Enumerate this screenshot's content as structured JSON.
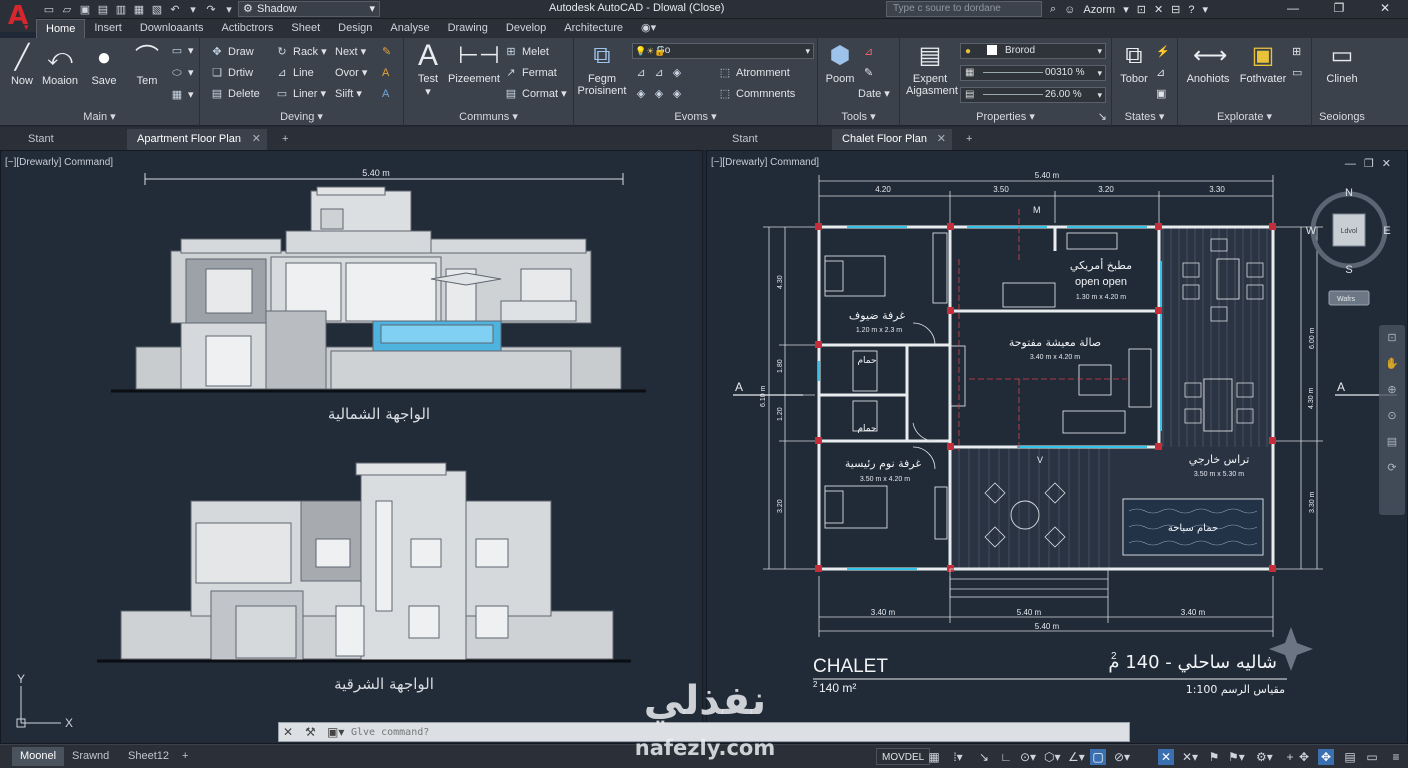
{
  "app": {
    "logo_letter": "A",
    "title": "Autodesk AutoCAD - Dlowal (Close)",
    "workspace": "Shadow",
    "search_placeholder": "Type c soure to dordane",
    "user": "Azorm"
  },
  "ribbon_tabs": [
    "Home",
    "Insert",
    "Downloaants",
    "Actibctrors",
    "Sheet",
    "Design",
    "Analyse",
    "Drawing",
    "Develop",
    "Architecture"
  ],
  "panels": {
    "main": {
      "title": "Main",
      "buttons": [
        "Now",
        "Moaion",
        "Save",
        "Tem"
      ]
    },
    "deving": {
      "title": "Deving",
      "items": [
        "Draw",
        "Drtiw",
        "Delete",
        "Rack",
        "Line",
        "Liner",
        "Next",
        "Ovor",
        "Siift"
      ]
    },
    "communs": {
      "title": "Communs",
      "buttons": [
        "Test",
        "Pizeement"
      ],
      "items": [
        "Melet",
        "Fermat",
        "Cormat"
      ]
    },
    "evoms": {
      "title": "Evoms",
      "buttons": [
        "Fegm Proisinent"
      ],
      "combo": "Go",
      "items": [
        "Atromment",
        "Commnents"
      ]
    },
    "tools": {
      "title": "Tools",
      "buttons": [
        "Poom",
        "Date"
      ]
    },
    "properties": {
      "title": "Properties",
      "buttons": [
        "Expent Aigasment"
      ],
      "layer": "Brorod",
      "opacity": "00310 %",
      "scale": "26.00 %"
    },
    "states": {
      "title": "States",
      "buttons": [
        "Tobor"
      ]
    },
    "explorate": {
      "title": "Explorate",
      "buttons": [
        "Anohiots",
        "Fothvater"
      ]
    },
    "seoiongs": {
      "title": "Seoiongs",
      "buttons": [
        "Clineh"
      ]
    }
  },
  "doc_tabs": {
    "left": [
      {
        "label": "Stant"
      },
      {
        "label": "Apartment Floor Plan"
      }
    ],
    "right": [
      {
        "label": "Stant"
      },
      {
        "label": "Chalet Floor Plan"
      }
    ]
  },
  "viewports": {
    "left_label": "[−][Drewarly] Command]",
    "right_label": "[−][Drewarly] Command]"
  },
  "elevations": {
    "north_label": "الواجهة الشمالية",
    "east_label": "الواجهة الشرقية",
    "width_dim": "5.40 m"
  },
  "plan": {
    "top_total": "5.40 m",
    "top_dims": [
      "4.20",
      "3.50",
      "3.20",
      "3.30"
    ],
    "bottom_dims": [
      "3.40 m",
      "5.40 m",
      "3.40 m"
    ],
    "bottom_total": "5.40 m",
    "left_dims": [
      "4.30",
      "1.80",
      "1.20",
      "3.20"
    ],
    "left_total": "6.10 m",
    "right_dims": [
      "6.00 m",
      "3.30 m"
    ],
    "right_total": "4.30 m",
    "rooms": [
      {
        "name": "غرفة ضيوف",
        "size": "1.20 m x 2.3 m"
      },
      {
        "name": "مطبخ أمريكي",
        "name2": "open open",
        "size": "1.30 m x 4.20 m"
      },
      {
        "name": "صالة معيشة مفتوحة",
        "size": "3.40 m x 4.20 m"
      },
      {
        "name": "حمام"
      },
      {
        "name": "حمام"
      },
      {
        "name": "غرفة نوم رئيسية",
        "size": "3.50 m x 4.20 m"
      },
      {
        "name": "تراس خارجي",
        "size": "3.50 m x 5.30 m"
      },
      {
        "name": "حمام سباحة"
      }
    ],
    "section_marks": [
      "A",
      "A",
      "V",
      "M"
    ],
    "compass": {
      "n": "N",
      "s": "S",
      "e": "E",
      "w": "W",
      "center": "Ldvol",
      "ucs": "Wafrs"
    },
    "title_en": "CHALET",
    "area_en": "140 m²",
    "area_sup": "2",
    "title_ar": "شاليه ساحلي - 140 م",
    "area_sup_ar": "2",
    "scale_ar": "مقياس الرسم 1:100"
  },
  "ucs": {
    "x": "X",
    "y": "Y"
  },
  "command": {
    "placeholder": "Glve command?"
  },
  "layouts": [
    "Moonel",
    "Srawnd",
    "Sheet12"
  ],
  "status": {
    "model": "MOVDEL"
  },
  "watermark": {
    "ar": "نفذلي",
    "en": "nafezly.com"
  }
}
